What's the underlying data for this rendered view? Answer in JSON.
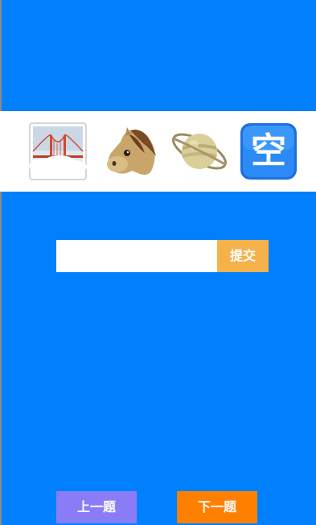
{
  "puzzle": {
    "emojis": [
      {
        "icon": "foggy-golden-gate-bridge-icon"
      },
      {
        "icon": "horse-face-icon"
      },
      {
        "icon": "ringed-planet-icon"
      },
      {
        "icon": "kanji-kong-empty-icon",
        "text": "空"
      }
    ]
  },
  "answer": {
    "value": "",
    "placeholder": ""
  },
  "submit_label": "提交",
  "nav": {
    "prev_label": "上一题",
    "next_label": "下一题"
  },
  "colors": {
    "background": "#0080fc",
    "submit": "#f5b24a",
    "prev": "#8a7cf7",
    "next": "#ff7f00"
  }
}
